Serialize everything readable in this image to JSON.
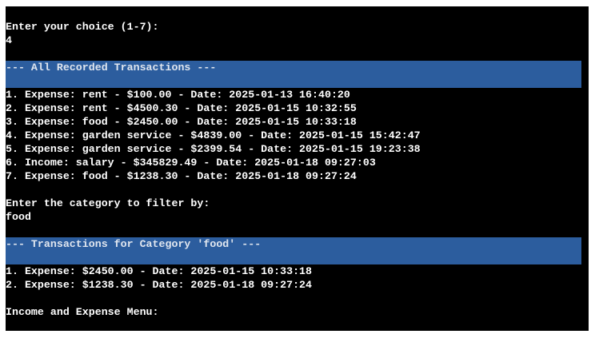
{
  "prompt": {
    "choice_text": "Enter your choice (1-7):",
    "choice_value": "4"
  },
  "all_header": "--- All Recorded Transactions ---",
  "all_transactions": [
    "1. Expense: rent - $100.00 - Date: 2025-01-13 16:40:20",
    "2. Expense: rent - $4500.30 - Date: 2025-01-15 10:32:55",
    "3. Expense: food - $2450.00 - Date: 2025-01-15 10:33:18",
    "4. Expense: garden service - $4839.00 - Date: 2025-01-15 15:42:47",
    "5. Expense: garden service - $2399.54 - Date: 2025-01-15 19:23:38",
    "6. Income: salary - $345829.49 - Date: 2025-01-18 09:27:03",
    "7. Expense: food - $1238.30 - Date: 2025-01-18 09:27:24"
  ],
  "filter": {
    "prompt_text": "Enter the category to filter by:",
    "value": "food"
  },
  "filtered_header": "--- Transactions for Category 'food' ---",
  "filtered_transactions": [
    "1. Expense: $2450.00 - Date: 2025-01-15 10:33:18",
    "2. Expense: $1238.30 - Date: 2025-01-18 09:27:24"
  ],
  "menu_title": "Income and Expense Menu:",
  "colors": {
    "background": "#000000",
    "text": "#ffffff",
    "banner": "#2c5d9e"
  }
}
